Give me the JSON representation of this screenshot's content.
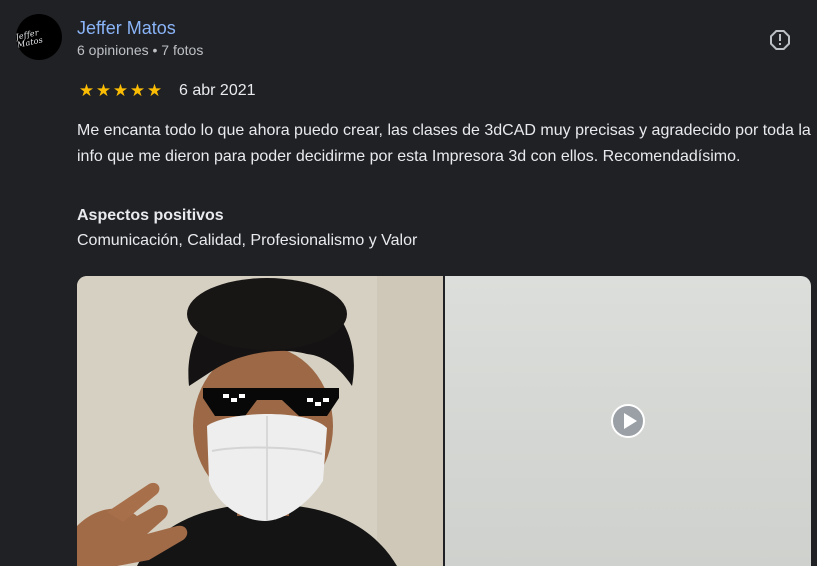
{
  "author": {
    "avatar_text": "Jeffer Matos",
    "name": "Jeffer Matos",
    "meta": "6 opiniones • 7 fotos"
  },
  "review": {
    "rating": 5,
    "rating_max": 5,
    "stars": [
      "★",
      "★",
      "★",
      "★",
      "★"
    ],
    "date": "6 abr 2021",
    "text": "Me encanta todo lo que ahora puedo crear, las clases de 3dCAD muy precisas y agradecido por toda la info que me dieron para poder decidirme por esta Impresora 3d con ellos. Recomendadísimo.",
    "aspects_title": "Aspectos positivos",
    "aspects_values": "Comunicación, Calidad, Profesionalismo y Valor"
  },
  "icons": {
    "report": "report-flag-icon",
    "play": "play-icon"
  },
  "colors": {
    "background": "#202124",
    "name_link": "#8ab4f8",
    "star": "#fbbc04",
    "text": "#e8eaed",
    "meta": "#bdc1c6"
  }
}
